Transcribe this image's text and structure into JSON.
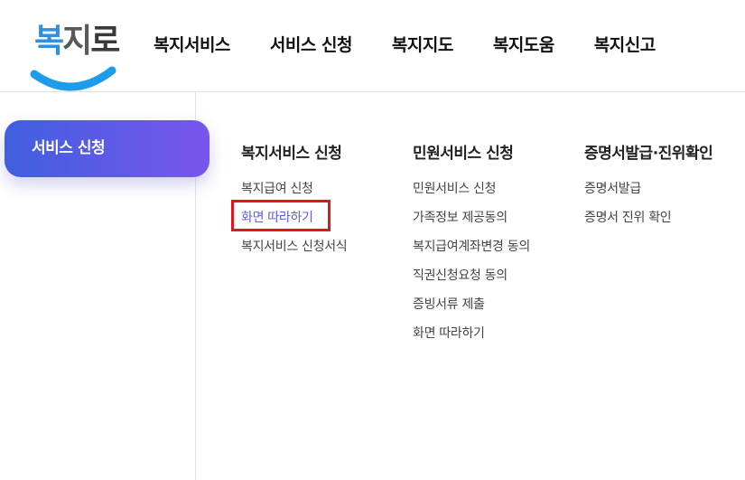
{
  "logo": {
    "text_1": "복",
    "text_2": "지",
    "text_3": "로"
  },
  "nav": {
    "items": [
      "복지서비스",
      "서비스 신청",
      "복지지도",
      "복지도움",
      "복지신고"
    ]
  },
  "sidebar": {
    "active_label": "서비스 신청"
  },
  "menu": {
    "columns": [
      {
        "title": "복지서비스 신청",
        "links": [
          "복지급여 신청",
          "화면 따라하기",
          "복지서비스 신청서식"
        ]
      },
      {
        "title": "민원서비스 신청",
        "links": [
          "민원서비스 신청",
          "가족정보 제공동의",
          "복지급여계좌변경 동의",
          "직권신청요청 동의",
          "증빙서류 제출",
          "화면 따라하기"
        ]
      },
      {
        "title": "증명서발급·진위확인",
        "links": [
          "증명서발급",
          "증명서 진위 확인"
        ]
      }
    ]
  },
  "colors": {
    "accent_start": "#3f5fdf",
    "accent_end": "#7a55ef",
    "link_active": "#5b5fd6",
    "highlight": "#e0161b"
  }
}
